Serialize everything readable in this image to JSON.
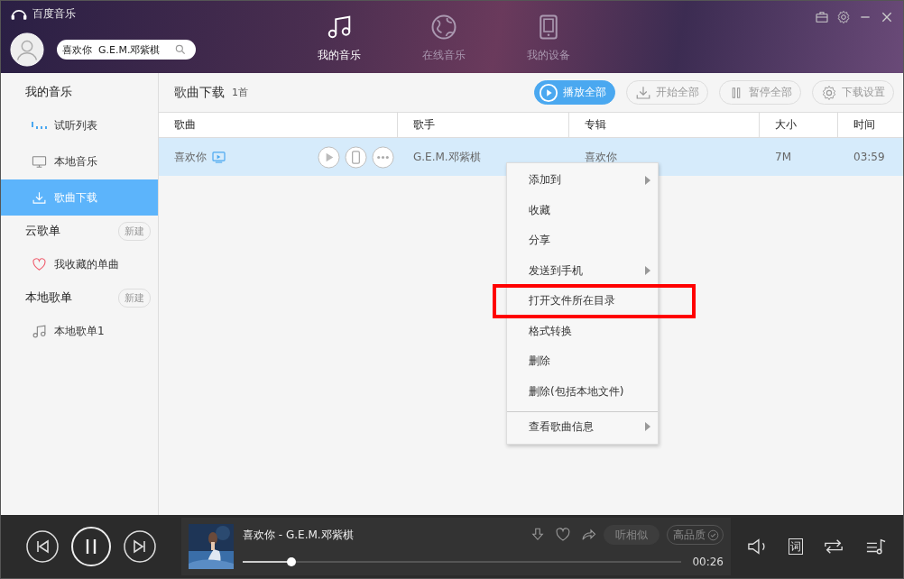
{
  "app": {
    "title": "百度音乐"
  },
  "search": {
    "value": "喜欢你  G.E.M.邓紫棋"
  },
  "nav_tabs": [
    {
      "label": "我的音乐",
      "selected": true,
      "kind": "note"
    },
    {
      "label": "在线音乐",
      "selected": false,
      "kind": "globe"
    },
    {
      "label": "我的设备",
      "selected": false,
      "kind": "device"
    }
  ],
  "sidebar": {
    "sections": [
      {
        "title": "我的音乐",
        "items": [
          {
            "label": "试听列表",
            "kind": "bars",
            "selected": false
          },
          {
            "label": "本地音乐",
            "kind": "monitor",
            "selected": false
          },
          {
            "label": "歌曲下载",
            "kind": "download",
            "selected": true
          }
        ]
      },
      {
        "title": "云歌单",
        "button": "新建",
        "items": [
          {
            "label": "我收藏的单曲",
            "kind": "heart",
            "selected": false
          }
        ]
      },
      {
        "title": "本地歌单",
        "button": "新建",
        "items": [
          {
            "label": "本地歌单1",
            "kind": "note",
            "selected": false
          }
        ]
      }
    ]
  },
  "main": {
    "title": "歌曲下载",
    "count": "1首",
    "actions": [
      {
        "label": "播放全部",
        "kind": "play",
        "primary": true
      },
      {
        "label": "开始全部",
        "kind": "download",
        "primary": false
      },
      {
        "label": "暂停全部",
        "kind": "pause",
        "primary": false
      },
      {
        "label": "下载设置",
        "kind": "gear",
        "primary": false
      }
    ],
    "table": {
      "columns": [
        "歌曲",
        "歌手",
        "专辑",
        "大小",
        "时间"
      ],
      "rows": [
        {
          "cells": [
            "喜欢你",
            "G.E.M.邓紫棋",
            "喜欢你",
            "7M",
            "03:59"
          ],
          "selected": true
        }
      ]
    }
  },
  "context_menu": {
    "items": [
      {
        "label": "添加到",
        "submenu": true,
        "highlighted": false,
        "separator_before": false
      },
      {
        "label": "收藏",
        "submenu": false,
        "highlighted": false,
        "separator_before": false
      },
      {
        "label": "分享",
        "submenu": false,
        "highlighted": false,
        "separator_before": false
      },
      {
        "label": "发送到手机",
        "submenu": true,
        "highlighted": false,
        "separator_before": false
      },
      {
        "label": "打开文件所在目录",
        "submenu": false,
        "highlighted": true,
        "separator_before": false
      },
      {
        "label": "格式转换",
        "submenu": false,
        "highlighted": false,
        "separator_before": false
      },
      {
        "label": "删除",
        "submenu": false,
        "highlighted": false,
        "separator_before": false
      },
      {
        "label": "删除(包括本地文件)",
        "submenu": false,
        "highlighted": false,
        "separator_before": false
      },
      {
        "label": "查看歌曲信息",
        "submenu": true,
        "highlighted": false,
        "separator_before": true
      }
    ]
  },
  "player": {
    "track": "喜欢你  - G.E.M.邓紫棋",
    "elapsed": "00:26",
    "level": 0.11,
    "similar_button": "听相似",
    "quality_button": "高品质",
    "lyrics_button": "词"
  }
}
